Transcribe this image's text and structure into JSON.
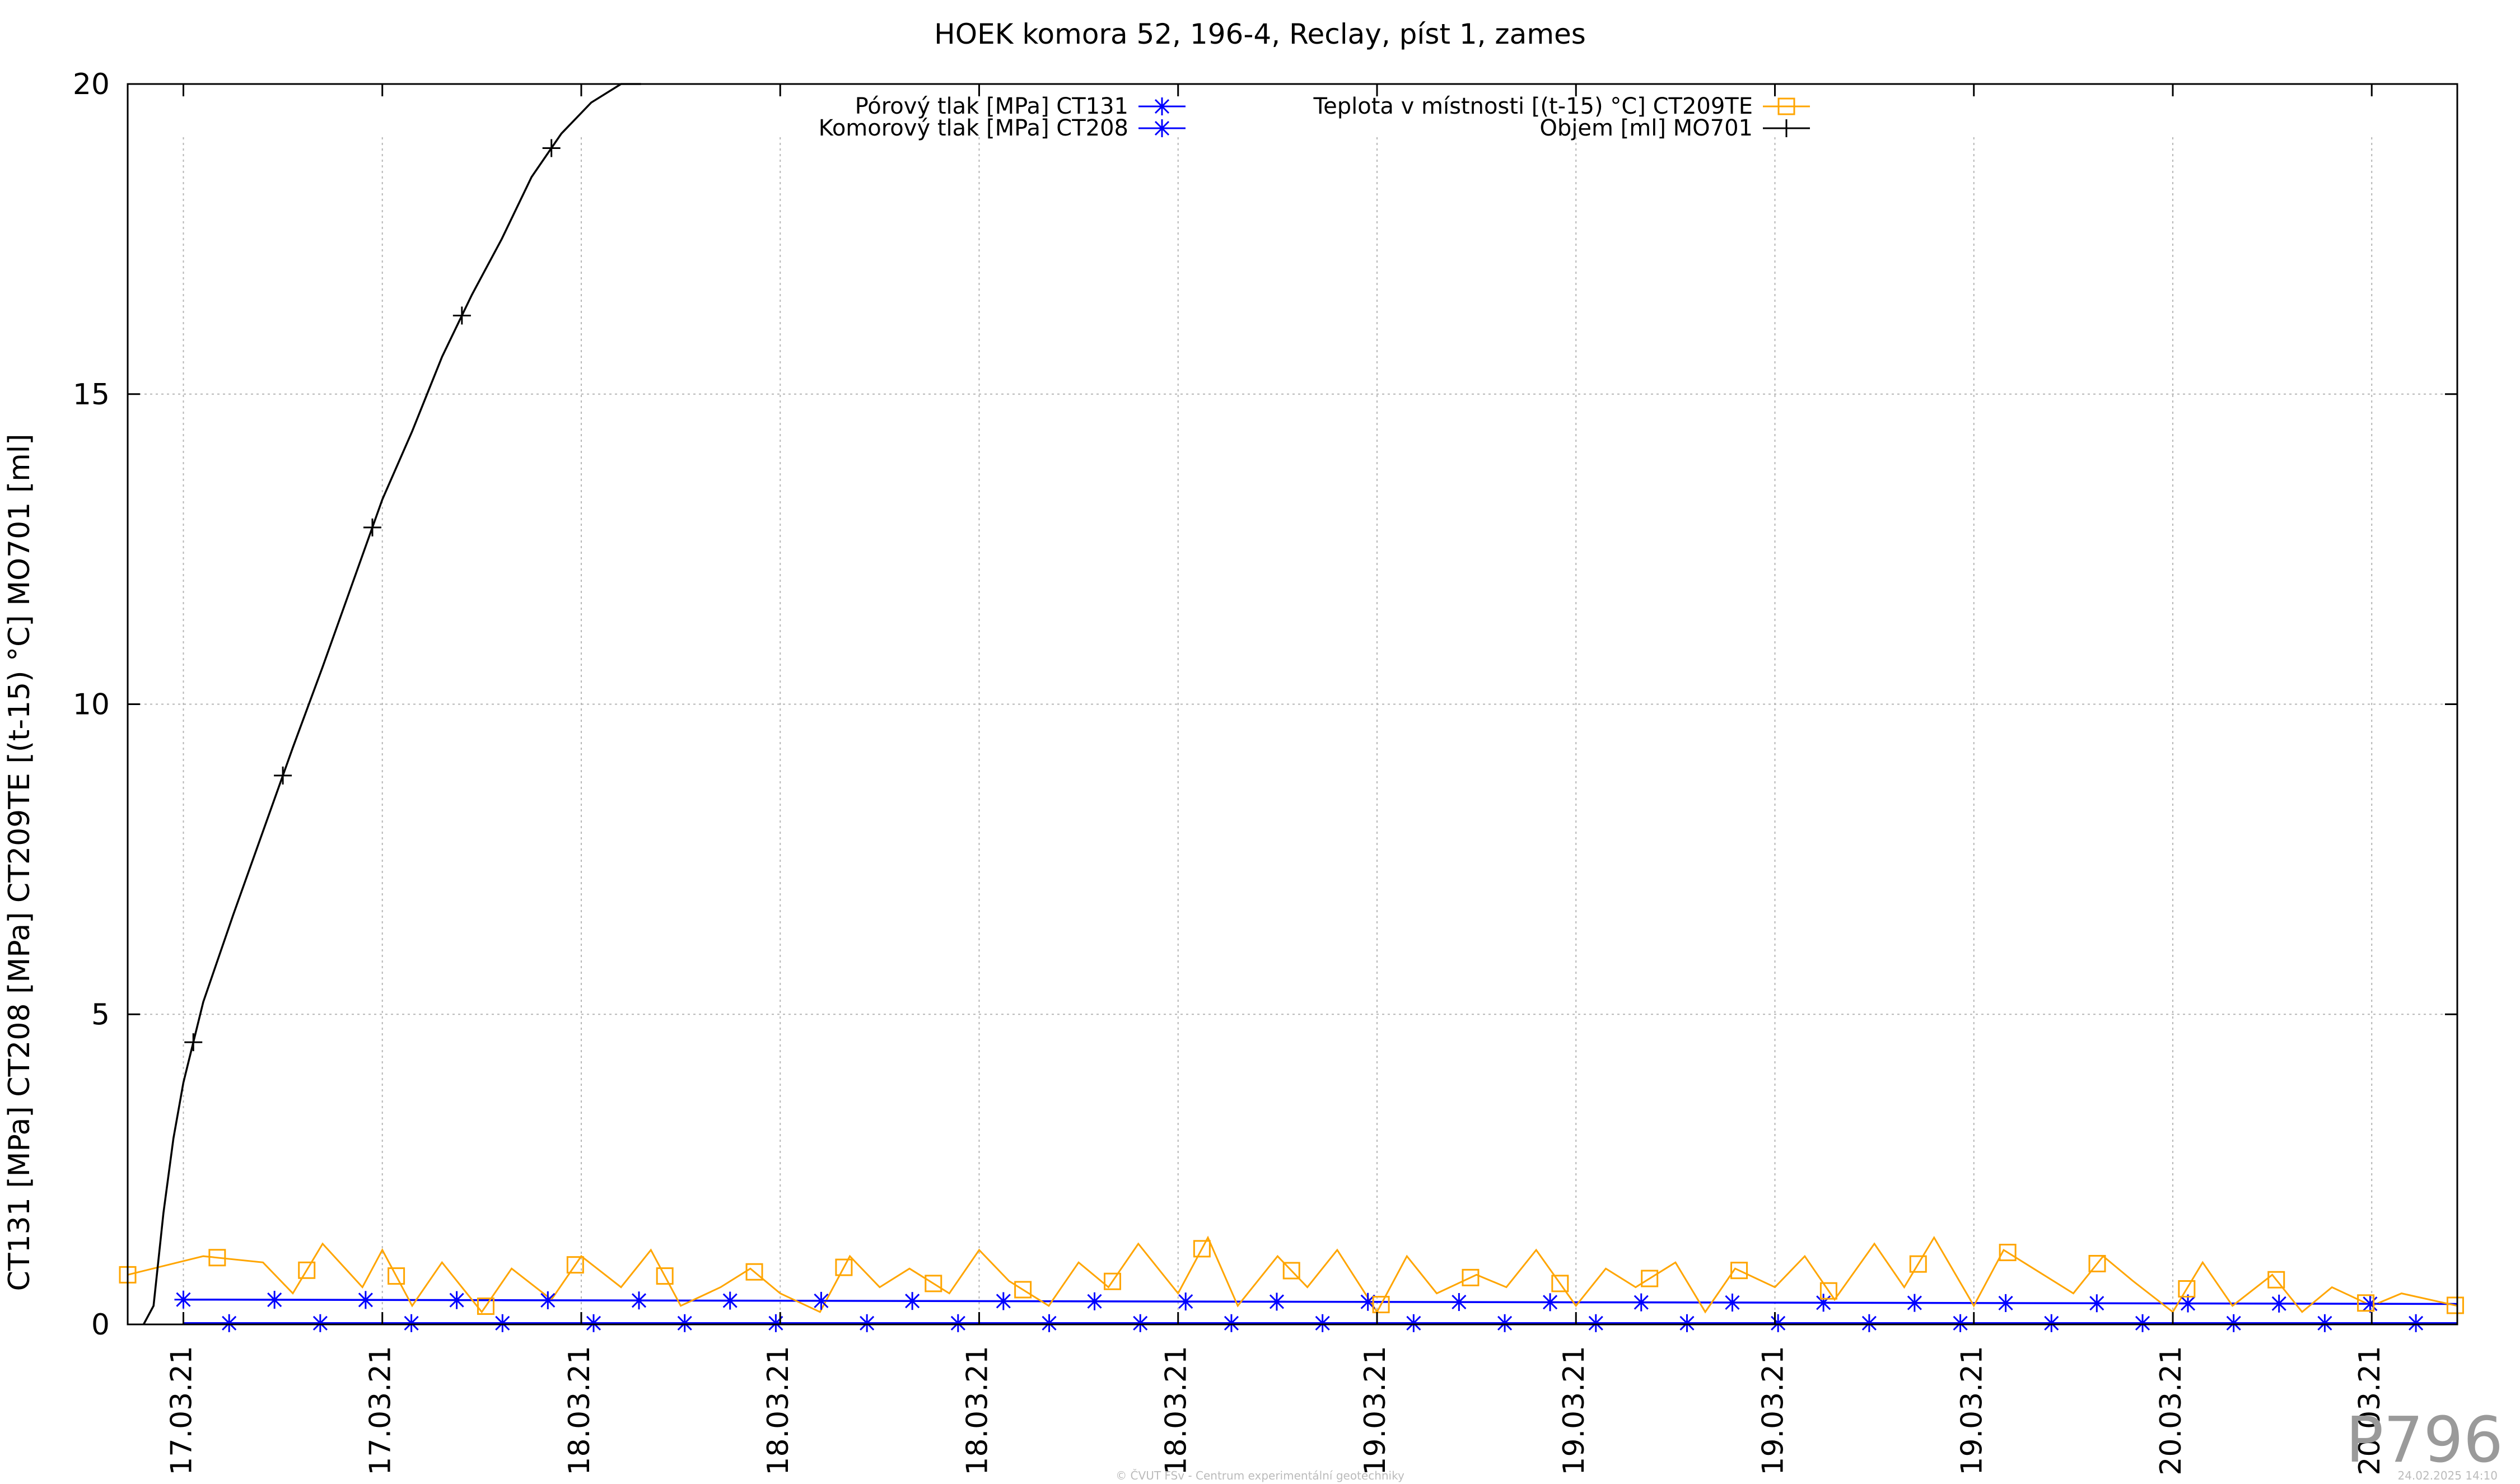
{
  "chart_data": {
    "type": "line",
    "title": "HOEK komora 52, 196-4, Reclay, píst 1, zames",
    "ylabel": "CT131 [MPa] CT208 [MPa] CT209TE [(t-15) °C] MO701 [ml]",
    "xlabel": "",
    "ylim": [
      0,
      20
    ],
    "yticks": [
      "0",
      "5",
      "10",
      "15",
      "20"
    ],
    "xlim": [
      -0.28,
      11.43
    ],
    "xticks": [
      "17.03.21",
      "17.03.21",
      "18.03.21",
      "18.03.21",
      "18.03.21",
      "18.03.21",
      "19.03.21",
      "19.03.21",
      "19.03.21",
      "19.03.21",
      "20.03.21",
      "20.03.21"
    ],
    "grid": true,
    "legend_position": "top",
    "series": [
      {
        "name": "Pórový tlak [MPa] CT131",
        "color": "#0000ff",
        "marker": "star",
        "x": [
          0,
          11.43
        ],
        "y": [
          0.4,
          0.33
        ]
      },
      {
        "name": "Komorový tlak [MPa] CT208",
        "color": "#0000ff",
        "marker": "star",
        "x": [
          0,
          11.43
        ],
        "y": [
          0.02,
          0.02
        ]
      },
      {
        "name": "Teplota v místnosti [(t-15) °C] CT209TE",
        "color": "#ffa500",
        "marker": "square",
        "x": [
          -0.28,
          0.1,
          0.4,
          0.55,
          0.7,
          0.9,
          1.0,
          1.15,
          1.3,
          1.5,
          1.65,
          1.85,
          2.0,
          2.2,
          2.35,
          2.5,
          2.7,
          2.85,
          3.0,
          3.2,
          3.35,
          3.5,
          3.65,
          3.85,
          4.0,
          4.15,
          4.35,
          4.5,
          4.65,
          4.8,
          5.0,
          5.15,
          5.3,
          5.5,
          5.65,
          5.8,
          6.0,
          6.15,
          6.3,
          6.5,
          6.65,
          6.8,
          7.0,
          7.15,
          7.3,
          7.5,
          7.65,
          7.8,
          8.0,
          8.15,
          8.3,
          8.5,
          8.65,
          8.8,
          9.0,
          9.15,
          9.3,
          9.5,
          9.65,
          9.8,
          10.0,
          10.15,
          10.3,
          10.5,
          10.65,
          10.8,
          11.0,
          11.15,
          11.43
        ],
        "y": [
          0.8,
          1.1,
          1.0,
          0.5,
          1.3,
          0.6,
          1.2,
          0.3,
          1.0,
          0.2,
          0.9,
          0.4,
          1.1,
          0.6,
          1.2,
          0.3,
          0.6,
          0.9,
          0.5,
          0.2,
          1.1,
          0.6,
          0.9,
          0.5,
          1.2,
          0.7,
          0.3,
          1.0,
          0.6,
          1.3,
          0.5,
          1.4,
          0.3,
          1.1,
          0.6,
          1.2,
          0.2,
          1.1,
          0.5,
          0.8,
          0.6,
          1.2,
          0.3,
          0.9,
          0.6,
          1.0,
          0.2,
          0.9,
          0.6,
          1.1,
          0.4,
          1.3,
          0.6,
          1.4,
          0.3,
          1.2,
          0.9,
          0.5,
          1.1,
          0.7,
          0.2,
          1.0,
          0.3,
          0.8,
          0.2,
          0.6,
          0.3,
          0.5,
          0.3
        ]
      },
      {
        "name": "Objem [ml] MO701",
        "color": "#000000",
        "marker": "plus",
        "x": [
          -0.2,
          -0.15,
          -0.1,
          -0.05,
          0,
          0.1,
          0.25,
          0.55,
          0.7,
          0.9,
          1.0,
          1.15,
          1.3,
          1.45,
          1.6,
          1.75,
          1.9,
          2.05,
          2.2,
          2.3
        ],
        "y": [
          0,
          0.3,
          1.8,
          3.0,
          3.9,
          5.2,
          6.6,
          9.3,
          10.6,
          12.4,
          13.3,
          14.4,
          15.6,
          16.6,
          17.5,
          18.5,
          19.2,
          19.7,
          20.0,
          20.0
        ]
      }
    ]
  },
  "footer": {
    "copyright": "© ČVUT FSv - Centrum experimentální geotechniky",
    "timestamp": "24.02.2025 14:10",
    "id": "P796"
  }
}
